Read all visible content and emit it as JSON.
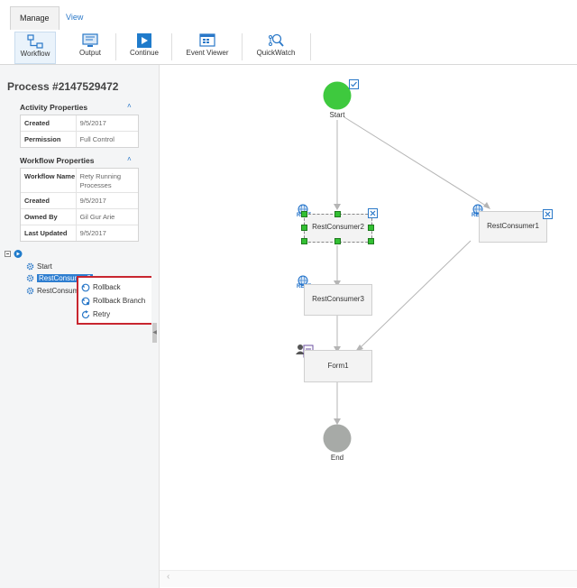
{
  "tabs": [
    {
      "label": "Manage",
      "active": true
    },
    {
      "label": "View",
      "active": false
    }
  ],
  "ribbon": {
    "workflow": "Workflow",
    "output": "Output",
    "continue": "Continue",
    "event_viewer": "Event Viewer",
    "quickwatch": "QuickWatch"
  },
  "left_panel": {
    "title": "Process #2147529472",
    "activity_properties": {
      "heading": "Activity Properties",
      "rows": [
        {
          "key": "Created",
          "value": "9/5/2017"
        },
        {
          "key": "Permission",
          "value": "Full Control"
        }
      ]
    },
    "workflow_properties": {
      "heading": "Workflow Properties",
      "rows": [
        {
          "key": "Workflow Name",
          "value": "Rety Running Processes"
        },
        {
          "key": "Created",
          "value": "9/5/2017"
        },
        {
          "key": "Owned By",
          "value": "Gil Gur Arie"
        },
        {
          "key": "Last Updated",
          "value": "9/5/2017"
        }
      ]
    },
    "tree": {
      "items": [
        "Start",
        "RestConsumer2",
        "RestConsumer3"
      ],
      "selected_label": "RestConsumer2"
    }
  },
  "context_menu": {
    "items": [
      "Rollback",
      "Rollback Branch",
      "Retry"
    ]
  },
  "canvas": {
    "start_label": "Start",
    "end_label": "End",
    "rest_badge": "REST",
    "nodes": [
      "RestConsumer2",
      "RestConsumer1",
      "RestConsumer3",
      "Form1"
    ]
  },
  "colors": {
    "accent": "#2a78c8",
    "start_circle": "#3ec93e",
    "end_circle": "#a7aaa7",
    "menu_border": "#c8262f",
    "selection": "#2e7ed0"
  }
}
